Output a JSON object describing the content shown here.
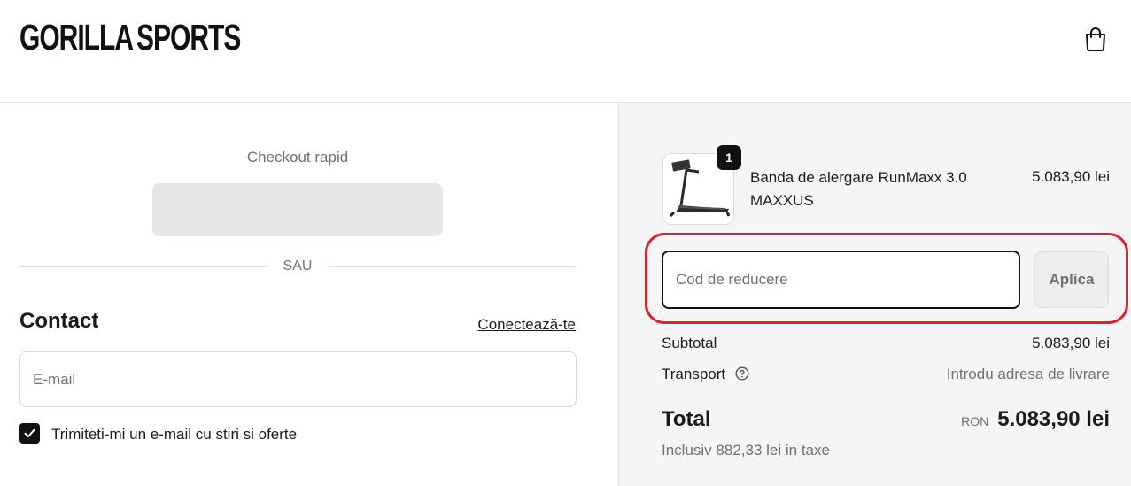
{
  "header": {
    "logo_left": "GORILLA",
    "logo_right": "SPORTS",
    "cart_icon": "shopping-bag-icon"
  },
  "express": {
    "title": "Checkout rapid",
    "divider": "SAU"
  },
  "contact": {
    "title": "Contact",
    "login_link": "Conectează-te",
    "email_placeholder": "E-mail",
    "newsletter_label": "Trimiteti-mi un e-mail cu stiri si oferte",
    "newsletter_checked": true
  },
  "summary": {
    "product": {
      "name": "Banda de alergare RunMaxx 3.0 MAXXUS",
      "price": "5.083,90 lei",
      "quantity": "1"
    },
    "discount_placeholder": "Cod de reducere",
    "apply_label": "Aplica",
    "subtotal_label": "Subtotal",
    "subtotal_value": "5.083,90 lei",
    "shipping_label": "Transport",
    "shipping_value": "Introdu adresa de livrare",
    "total_label": "Total",
    "currency": "RON",
    "total_value": "5.083,90 lei",
    "tax_note": "Inclusiv 882,33 lei in taxe"
  },
  "colors": {
    "highlight": "#e0202b",
    "summary_bg": "#f5f5f5",
    "text": "#1a1a1a",
    "muted": "#707070"
  }
}
